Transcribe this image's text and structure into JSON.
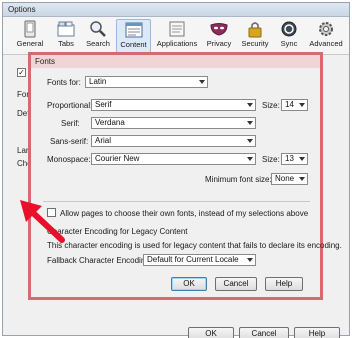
{
  "options_window": {
    "title": "Options",
    "panes": [
      {
        "label": "General",
        "icon": "general-icon"
      },
      {
        "label": "Tabs",
        "icon": "tabs-icon"
      },
      {
        "label": "Search",
        "icon": "search-icon"
      },
      {
        "label": "Content",
        "icon": "content-icon",
        "selected": true
      },
      {
        "label": "Applications",
        "icon": "applications-icon"
      },
      {
        "label": "Privacy",
        "icon": "privacy-icon"
      },
      {
        "label": "Security",
        "icon": "security-icon"
      },
      {
        "label": "Sync",
        "icon": "sync-icon"
      },
      {
        "label": "Advanced",
        "icon": "advanced-icon"
      }
    ],
    "fragments": {
      "fon": "Fon",
      "def": "Def",
      "lan": "Lan",
      "cho": "Cho"
    },
    "buttons": {
      "ok": "OK",
      "cancel": "Cancel",
      "help": "Help"
    }
  },
  "fonts_dialog": {
    "title": "Fonts",
    "fonts_for_label": "Fonts for:",
    "fonts_for_value": "Latin",
    "proportional_label": "Proportional:",
    "proportional_value": "Serif",
    "size_label": "Size:",
    "proportional_size": "14",
    "serif_label": "Serif:",
    "serif_value": "Verdana",
    "sans_serif_label": "Sans-serif:",
    "sans_serif_value": "Arial",
    "monospace_label": "Monospace:",
    "monospace_value": "Courier New",
    "monospace_size": "13",
    "min_font_size_label": "Minimum font size:",
    "min_font_size_value": "None",
    "allow_pages_label": "Allow pages to choose their own fonts, instead of my selections above",
    "allow_pages_checked": false,
    "encoding_heading": "Character Encoding for Legacy Content",
    "encoding_description": "This character encoding is used for legacy content that fails to declare its encoding.",
    "fallback_label": "Fallback Character Encoding:",
    "fallback_value": "Default for Current Locale",
    "buttons": {
      "ok": "OK",
      "cancel": "Cancel",
      "help": "Help"
    }
  },
  "colors": {
    "accent_border": "#d66a6f",
    "annotation_arrow": "#e8102a",
    "selected_pane": "#dce9f7"
  }
}
